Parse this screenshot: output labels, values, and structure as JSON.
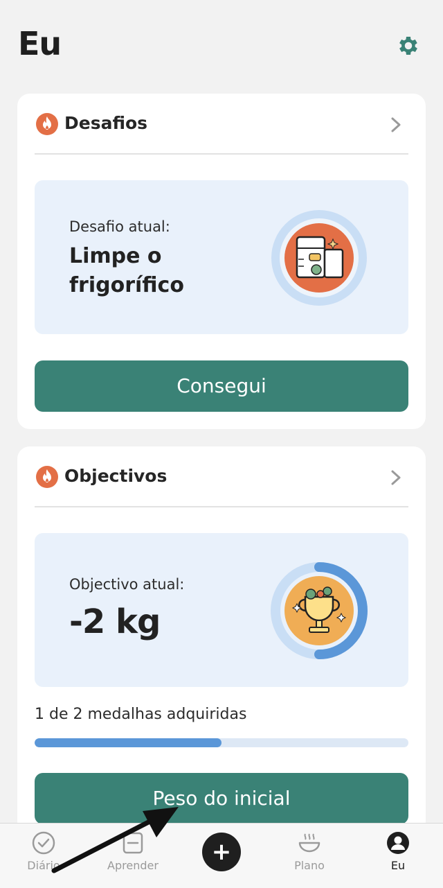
{
  "header": {
    "title": "Eu",
    "settings_icon": "gear-icon"
  },
  "colors": {
    "accent_teal": "#3a8276",
    "flame_orange": "#e36f46",
    "panel_blue": "#e9f1fb",
    "progress_blue": "#5b97d8"
  },
  "challenges": {
    "title": "Desafios",
    "current_label": "Desafio atual:",
    "current_value": "Limpe o frigorífico",
    "button_label": "Consegui",
    "icon": "flame-icon",
    "illustration": "fridge-icon"
  },
  "goals": {
    "title": "Objectivos",
    "current_label": "Objectivo atual:",
    "current_value": "-2 kg",
    "medals_text": "1 de 2 medalhas adquiridas",
    "medals_progress": 0.5,
    "ring_progress": 0.5,
    "button_label": "Peso do inicial",
    "icon": "flame-icon",
    "illustration": "trophy-icon"
  },
  "nav": {
    "items": [
      {
        "label": "Diário",
        "icon": "check-circle-icon"
      },
      {
        "label": "Aprender",
        "icon": "book-icon"
      },
      {
        "label": "",
        "icon": "plus-icon"
      },
      {
        "label": "Plano",
        "icon": "bowl-icon"
      },
      {
        "label": "Eu",
        "icon": "profile-icon",
        "active": true
      }
    ]
  }
}
